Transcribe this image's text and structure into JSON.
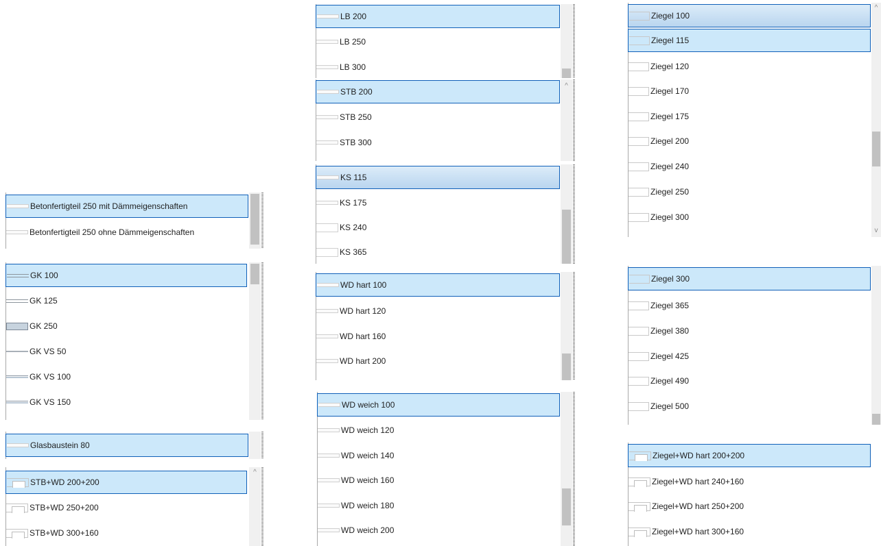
{
  "left_column": {
    "betonfertigteil_list": {
      "items": [
        {
          "label": "Betonfertigteil 250 mit Dämmeigenschaften",
          "icon": "flat-wall-icon",
          "selected": true
        },
        {
          "label": "Betonfertigteil 250 ohne Dämmeigenschaften",
          "icon": "flat-wall-icon",
          "selected": false
        }
      ]
    },
    "gk_list": {
      "items": [
        {
          "label": "GK 100",
          "icon": "double-line-wall-icon",
          "selected": true
        },
        {
          "label": "GK 125",
          "icon": "double-line-wall-icon",
          "selected": false
        },
        {
          "label": "GK 250",
          "icon": "box-wall-icon",
          "selected": false
        },
        {
          "label": "GK VS 50",
          "icon": "thin-wall-icon",
          "selected": false
        },
        {
          "label": "GK VS 100",
          "icon": "layered-wall-icon",
          "selected": false
        },
        {
          "label": "GK VS 150",
          "icon": "layered-wall-icon",
          "selected": false
        }
      ]
    },
    "glasbaustein_list": {
      "items": [
        {
          "label": "Glasbaustein 80",
          "icon": "flat-wall-icon",
          "selected": true
        }
      ]
    },
    "stb_wd_list": {
      "items": [
        {
          "label": "STB+WD 200+200",
          "icon": "composite-wall-icon",
          "selected": true
        },
        {
          "label": "STB+WD 250+200",
          "icon": "composite-wall-icon",
          "selected": false
        },
        {
          "label": "STB+WD 300+160",
          "icon": "composite-wall-icon",
          "selected": false
        }
      ]
    }
  },
  "middle_column": {
    "lb_list": {
      "items": [
        {
          "label": "LB 200",
          "icon": "flat-wall-icon",
          "selected": true
        },
        {
          "label": "LB 250",
          "icon": "flat-wall-icon",
          "selected": false
        },
        {
          "label": "LB 300",
          "icon": "flat-wall-icon",
          "selected": false
        }
      ]
    },
    "stb_list": {
      "items": [
        {
          "label": "STB 200",
          "icon": "flat-wall-icon",
          "selected": true
        },
        {
          "label": "STB 250",
          "icon": "flat-wall-icon",
          "selected": false
        },
        {
          "label": "STB 300",
          "icon": "flat-wall-icon",
          "selected": false
        }
      ]
    },
    "ks_list": {
      "items": [
        {
          "label": "KS 115",
          "icon": "flat-wall-icon",
          "selected": true
        },
        {
          "label": "KS 175",
          "icon": "flat-wall-icon",
          "selected": false
        },
        {
          "label": "KS 240",
          "icon": "tile-wall-icon",
          "selected": false
        },
        {
          "label": "KS 365",
          "icon": "tile-wall-icon",
          "selected": false
        }
      ]
    },
    "wd_hart_list": {
      "items": [
        {
          "label": "WD hart 100",
          "icon": "flat-wall-icon",
          "selected": true
        },
        {
          "label": "WD hart 120",
          "icon": "flat-wall-icon",
          "selected": false
        },
        {
          "label": "WD hart 160",
          "icon": "flat-wall-icon",
          "selected": false
        },
        {
          "label": "WD hart 200",
          "icon": "flat-wall-icon",
          "selected": false
        }
      ]
    },
    "wd_weich_list": {
      "items": [
        {
          "label": "WD weich 100",
          "icon": "flat-wall-icon",
          "selected": true
        },
        {
          "label": "WD weich 120",
          "icon": "flat-wall-icon",
          "selected": false
        },
        {
          "label": "WD weich 140",
          "icon": "flat-wall-icon",
          "selected": false
        },
        {
          "label": "WD weich 160",
          "icon": "flat-wall-icon",
          "selected": false
        },
        {
          "label": "WD weich 180",
          "icon": "flat-wall-icon",
          "selected": false
        },
        {
          "label": "WD weich 200",
          "icon": "flat-wall-icon",
          "selected": false
        }
      ]
    }
  },
  "right_column": {
    "ziegel_list_1": {
      "items": [
        {
          "label": "Ziegel 100",
          "icon": "flat-wall-icon",
          "selected": true
        },
        {
          "label": "Ziegel 115",
          "icon": "flat-wall-icon",
          "selected": true
        },
        {
          "label": "Ziegel 120",
          "icon": "flat-wall-icon",
          "selected": false
        },
        {
          "label": "Ziegel 170",
          "icon": "flat-wall-icon",
          "selected": false
        },
        {
          "label": "Ziegel 175",
          "icon": "flat-wall-icon",
          "selected": false
        },
        {
          "label": "Ziegel 200",
          "icon": "flat-wall-icon",
          "selected": false
        },
        {
          "label": "Ziegel 240",
          "icon": "tile-wall-icon",
          "selected": false
        },
        {
          "label": "Ziegel 250",
          "icon": "tile-wall-icon",
          "selected": false
        },
        {
          "label": "Ziegel 300",
          "icon": "tile-wall-icon",
          "selected": false
        }
      ]
    },
    "ziegel_list_2": {
      "items": [
        {
          "label": "Ziegel 300",
          "icon": "tile-wall-icon",
          "selected": true
        },
        {
          "label": "Ziegel 365",
          "icon": "tile-wall-icon",
          "selected": false
        },
        {
          "label": "Ziegel 380",
          "icon": "tile-wall-icon",
          "selected": false
        },
        {
          "label": "Ziegel 425",
          "icon": "tile-wall-icon",
          "selected": false
        },
        {
          "label": "Ziegel 490",
          "icon": "tile-wall-icon",
          "selected": false
        },
        {
          "label": "Ziegel 500",
          "icon": "tile-wall-icon",
          "selected": false
        }
      ]
    },
    "ziegel_wd_list": {
      "items": [
        {
          "label": "Ziegel+WD hart 200+200",
          "icon": "composite-wall-icon",
          "selected": true
        },
        {
          "label": "Ziegel+WD hart 240+160",
          "icon": "composite-wall-icon",
          "selected": false
        },
        {
          "label": "Ziegel+WD hart 250+200",
          "icon": "composite-wall-icon",
          "selected": false
        },
        {
          "label": "Ziegel+WD hart 300+160",
          "icon": "composite-wall-icon",
          "selected": false
        }
      ]
    }
  },
  "colors": {
    "selection_fill": "#cce8fa",
    "selection_border": "#0f5fb8",
    "scrollbar_track": "#f0f0f0",
    "scrollbar_thumb": "#c1c1c1"
  }
}
